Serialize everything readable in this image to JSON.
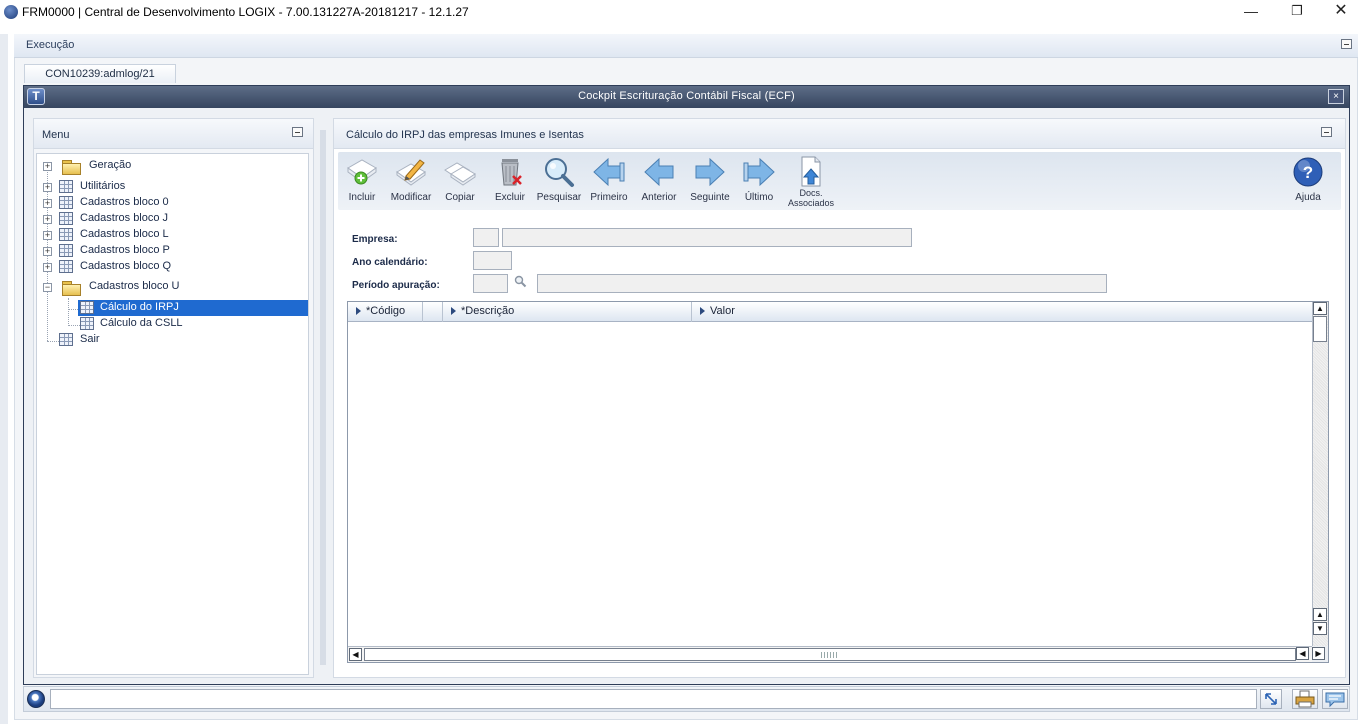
{
  "window": {
    "title": "FRM0000 | Central de Desenvolvimento LOGIX  -  7.00.131227A-20181217  -  12.1.27",
    "minimize_glyph": "—",
    "maximize_glyph": "❐",
    "close_glyph": "✕"
  },
  "exec_bar": {
    "label": "Execução"
  },
  "tab": {
    "label": "CON10239:admlog/21"
  },
  "app_window": {
    "title": "Cockpit Escrituração Contábil Fiscal (ECF)",
    "logo": "T",
    "close_glyph": "×"
  },
  "menu": {
    "header": "Menu",
    "items": [
      {
        "label": "Geração",
        "icon": "folder-icon"
      },
      {
        "label": "Utilitários",
        "icon": "table-icon"
      },
      {
        "label": "Cadastros bloco 0",
        "icon": "table-icon"
      },
      {
        "label": "Cadastros bloco J",
        "icon": "table-icon"
      },
      {
        "label": "Cadastros bloco L",
        "icon": "table-icon"
      },
      {
        "label": "Cadastros bloco P",
        "icon": "table-icon"
      },
      {
        "label": "Cadastros bloco Q",
        "icon": "table-icon"
      },
      {
        "label": "Cadastros bloco U",
        "icon": "folder-open-icon"
      },
      {
        "label": "Cálculo do IRPJ",
        "icon": "table-icon",
        "selected": true
      },
      {
        "label": "Cálculo da CSLL",
        "icon": "table-icon"
      },
      {
        "label": "Sair",
        "icon": "table-icon"
      }
    ]
  },
  "form": {
    "header": "Cálculo do IRPJ das empresas Imunes e Isentas",
    "toolbar": [
      {
        "label": "Incluir",
        "icon": "add-icon"
      },
      {
        "label": "Modificar",
        "icon": "edit-icon"
      },
      {
        "label": "Copiar",
        "icon": "copy-icon"
      },
      {
        "label": "Excluir",
        "icon": "delete-icon"
      },
      {
        "label": "Pesquisar",
        "icon": "search-icon"
      },
      {
        "label": "Primeiro",
        "icon": "first-icon"
      },
      {
        "label": "Anterior",
        "icon": "previous-icon"
      },
      {
        "label": "Seguinte",
        "icon": "next-icon"
      },
      {
        "label": "Último",
        "icon": "last-icon"
      },
      {
        "label": "Docs. Associados",
        "icon": "documents-icon"
      },
      {
        "label": "Ajuda",
        "icon": "help-icon"
      }
    ],
    "fields": {
      "empresa_label": "Empresa:",
      "ano_label": "Ano calendário:",
      "periodo_label": "Período apuração:",
      "empresa_code": "",
      "empresa_name": "",
      "ano": "",
      "periodo_code": "",
      "periodo_desc": ""
    },
    "grid": {
      "columns": [
        "*Código",
        "*Descrição",
        "Valor"
      ],
      "rows": []
    }
  },
  "statusbar": {
    "message": ""
  },
  "colors": {
    "selection": "#1f6ad0",
    "window_title": "#36455f",
    "toolbar_arrow": "#7eb5e6"
  }
}
